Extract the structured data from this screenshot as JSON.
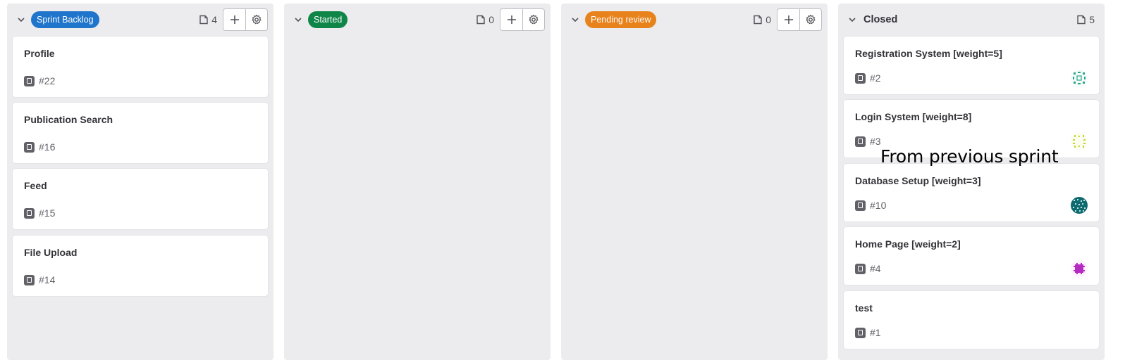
{
  "columns": [
    {
      "label": "Sprint Backlog",
      "label_style": "pill",
      "label_color": "#1f75cb",
      "count": "4",
      "has_actions": true,
      "cards": [
        {
          "title": "Profile",
          "ref": "#22"
        },
        {
          "title": "Publication Search",
          "ref": "#16"
        },
        {
          "title": "Feed",
          "ref": "#15"
        },
        {
          "title": "File Upload",
          "ref": "#14"
        }
      ]
    },
    {
      "label": "Started",
      "label_style": "pill",
      "label_color": "#108548",
      "count": "0",
      "has_actions": true,
      "cards": []
    },
    {
      "label": "Pending review",
      "label_style": "pill",
      "label_color": "#e8821a",
      "count": "0",
      "has_actions": true,
      "cards": []
    },
    {
      "label": "Closed",
      "label_style": "plain",
      "label_color": "#333238",
      "count": "5",
      "has_actions": false,
      "cards": [
        {
          "title": "Registration System [weight=5]",
          "ref": "#2",
          "avatar_color": "#2ba58a"
        },
        {
          "title": "Login System [weight=8]",
          "ref": "#3",
          "avatar_color": "#c7d629"
        },
        {
          "title": "Database Setup [weight=3]",
          "ref": "#10",
          "avatar_color": "#0e6a6e"
        },
        {
          "title": "Home Page [weight=2]",
          "ref": "#4",
          "avatar_color": "#b52bc2"
        },
        {
          "title": "test",
          "ref": "#1"
        }
      ]
    }
  ],
  "icons": {
    "collapse": "chevron-down-icon",
    "count": "issues-icon",
    "add": "plus-icon",
    "settings": "gear-icon",
    "issue": "issue-type-icon"
  },
  "annotation": "From previous sprint"
}
